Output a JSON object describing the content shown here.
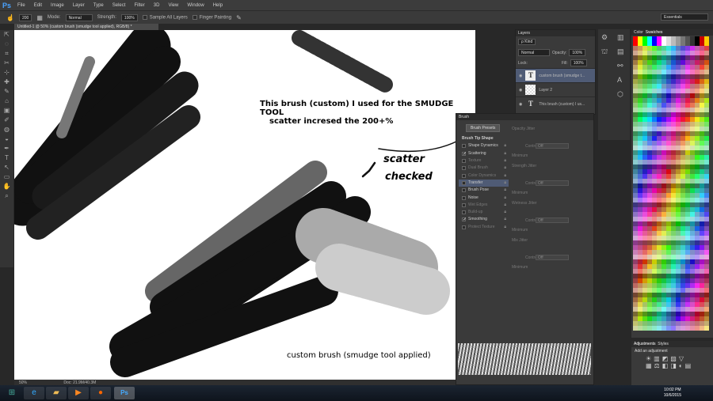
{
  "menu": {
    "logo": "Ps",
    "items": [
      "File",
      "Edit",
      "Image",
      "Layer",
      "Type",
      "Select",
      "Filter",
      "3D",
      "View",
      "Window",
      "Help"
    ]
  },
  "options": {
    "size": "200",
    "mode_label": "Mode:",
    "mode": "Normal",
    "strength_label": "Strength:",
    "strength": "100%",
    "sample_all": "Sample All Layers",
    "finger": "Finger Painting",
    "workspace": "Essentials"
  },
  "document": {
    "tab": "Untitled-1 @ 50% (custom brush (smudge tool applied), RGB/8) *",
    "zoom": "50%",
    "doc_info": "Doc: 21.9M/40.3M"
  },
  "annotations": {
    "top": "This brush (custom) I used for the SMUDGE TOOL",
    "top2": "scatter incresed the 200+%",
    "scatter": "scatter",
    "checked": "checked",
    "bottom": "custom brush (smudge tool applied)"
  },
  "layers": {
    "tab": "Layers",
    "kind": "ρ Kind",
    "blend": "Normal",
    "opacity_label": "Opacity:",
    "opacity": "100%",
    "lock_label": "Lock:",
    "fill_label": "Fill:",
    "fill": "100%",
    "items": [
      {
        "name": "custom brush (smudge t...",
        "type": "T"
      },
      {
        "name": "Layer 2",
        "type": ""
      },
      {
        "name": "This brush (custom) I us...",
        "type": "T"
      }
    ]
  },
  "swatches": {
    "tabs": [
      "Color",
      "Swatches"
    ]
  },
  "adjustments": {
    "tabs": [
      "Adjustments",
      "Styles"
    ],
    "title": "Add an adjustment"
  },
  "brush": {
    "tab": "Brush",
    "presets": "Brush Presets",
    "tip_shape": "Brush Tip Shape",
    "items": [
      {
        "label": "Shape Dynamics",
        "checked": false
      },
      {
        "label": "Scattering",
        "checked": true
      },
      {
        "label": "Texture",
        "checked": false
      },
      {
        "label": "Dual Brush",
        "checked": false
      },
      {
        "label": "Color Dynamics",
        "checked": false
      },
      {
        "label": "Transfer",
        "checked": false
      },
      {
        "label": "Brush Pose",
        "checked": false
      },
      {
        "label": "Noise",
        "checked": false
      },
      {
        "label": "Wet Edges",
        "checked": false
      },
      {
        "label": "Build-up",
        "checked": false
      },
      {
        "label": "Smoothing",
        "checked": true
      },
      {
        "label": "Protect Texture",
        "checked": false
      }
    ],
    "right": {
      "opacity_jitter": "Opacity Jitter",
      "control": "Control:",
      "off": "Off",
      "minimum": "Minimum",
      "strength_jitter": "Strength Jitter",
      "wetness_jitter": "Wetness Jitter",
      "mix_jitter": "Mix Jitter"
    }
  },
  "taskbar": {
    "time": "10:02 PM",
    "date": "10/6/2015",
    "ps": "Ps"
  }
}
